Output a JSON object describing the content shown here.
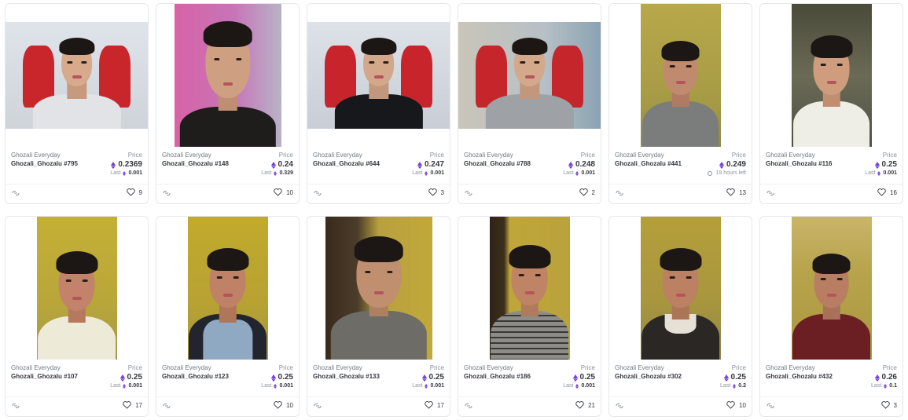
{
  "labels": {
    "price": "Price",
    "last": "Last"
  },
  "colors": {
    "eth_accent": "#7b3fe4",
    "border": "#e5e8eb"
  },
  "icons": {
    "currency": "eth-icon",
    "link": "link-icon",
    "favorite": "heart-icon",
    "time": "clock-icon"
  },
  "cards": [
    {
      "collection": "Ghozali Everyday",
      "name": "Ghozali_Ghozalu #795",
      "price": "0.2369",
      "last": "0.001",
      "favorites": "9"
    },
    {
      "collection": "Ghozali Everyday",
      "name": "Ghozali_Ghozalu #148",
      "price": "0.24",
      "last": "0.329",
      "favorites": "10"
    },
    {
      "collection": "Ghozali Everyday",
      "name": "Ghozali_Ghozalu #644",
      "price": "0.247",
      "last": "0.001",
      "favorites": "3"
    },
    {
      "collection": "Ghozali Everyday",
      "name": "Ghozali_Ghozalu #788",
      "price": "0.248",
      "last": "0.001",
      "favorites": "2"
    },
    {
      "collection": "Ghozali Everyday",
      "name": "Ghozali_Ghozalu #441",
      "price": "0.249",
      "time_left": "19 hours left",
      "favorites": "13"
    },
    {
      "collection": "Ghozali Everyday",
      "name": "Ghozali_Ghozalu #116",
      "price": "0.25",
      "last": "0.001",
      "favorites": "16"
    },
    {
      "collection": "Ghozali Everyday",
      "name": "Ghozali_Ghozalu #107",
      "price": "0.25",
      "last": "0.001",
      "favorites": "17"
    },
    {
      "collection": "Ghozali Everyday",
      "name": "Ghozali_Ghozalu #123",
      "price": "0.25",
      "last": "0.001",
      "favorites": "10"
    },
    {
      "collection": "Ghozali Everyday",
      "name": "Ghozali_Ghozalu #133",
      "price": "0.25",
      "last": "0.001",
      "favorites": "17"
    },
    {
      "collection": "Ghozali Everyday",
      "name": "Ghozali_Ghozalu #186",
      "price": "0.25",
      "last": "0.001",
      "favorites": "21"
    },
    {
      "collection": "Ghozali Everyday",
      "name": "Ghozali_Ghozalu #302",
      "price": "0.25",
      "last": "0.2",
      "favorites": "10"
    },
    {
      "collection": "Ghozali Everyday",
      "name": "Ghozali_Ghozalu #432",
      "price": "0.26",
      "last": "0.1",
      "favorites": "3"
    }
  ]
}
